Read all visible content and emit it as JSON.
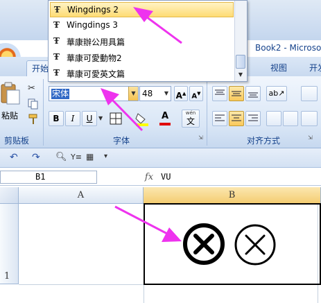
{
  "window": {
    "doc_title": "Book2 - Microso"
  },
  "ribbon": {
    "tabs": {
      "home": "开始",
      "view": "视图",
      "developer": "开发"
    },
    "clipboard": {
      "paste_label": "粘贴",
      "group_label": "剪贴板"
    },
    "font": {
      "name": "宋体",
      "size": "48",
      "group_label": "字体",
      "bold": "B",
      "italic": "I",
      "underline": "U",
      "font_color_letter": "A",
      "phonetic_label": "文",
      "phonetic_top": "wén"
    },
    "alignment": {
      "group_label": "对齐方式"
    }
  },
  "formula_bar": {
    "name_box": "B1",
    "fx": "fx",
    "value": "VU"
  },
  "sheet": {
    "columns": [
      "A",
      "B"
    ],
    "rows": [
      "1"
    ]
  },
  "font_dropdown": {
    "items": [
      {
        "label": "Wingdings 2",
        "highlighted": true
      },
      {
        "label": "Wingdings 3",
        "highlighted": false
      },
      {
        "label": "華康辦公用具篇",
        "highlighted": false
      },
      {
        "label": "華康可愛動物2",
        "highlighted": false
      },
      {
        "label": "華康可愛英文篇",
        "highlighted": false
      }
    ]
  },
  "colors": {
    "arrow": "#ee33ee",
    "highlight": "#fedb74",
    "selection": "#3169c6",
    "ribbon_text": "#15428b"
  },
  "icons": [
    "truetype-icon",
    "paste-icon",
    "cut-icon",
    "copy-icon",
    "format-painter-icon",
    "fill-color-icon",
    "font-color-icon",
    "border-icon",
    "circled-x-icon"
  ]
}
